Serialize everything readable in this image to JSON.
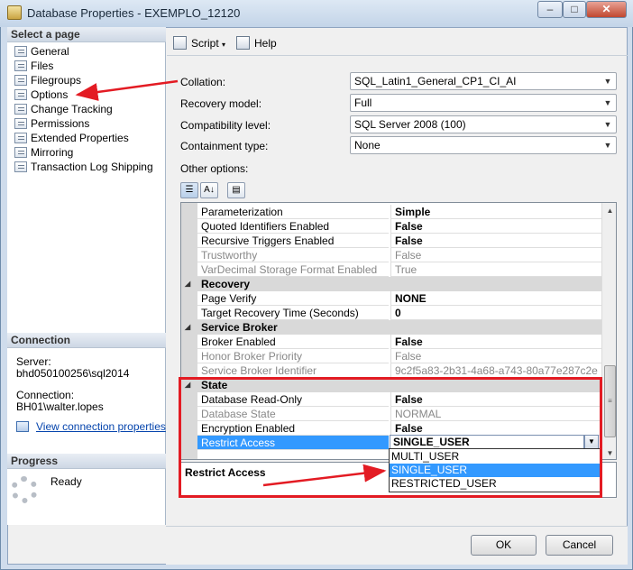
{
  "window": {
    "title": "Database Properties - EXEMPLO_12120",
    "controls": {
      "minimize": "–",
      "maximize": "□",
      "close": "✕"
    }
  },
  "left_panel": {
    "select_page_header": "Select a page",
    "pages": [
      {
        "label": "General",
        "icon": "page-icon"
      },
      {
        "label": "Files",
        "icon": "page-icon"
      },
      {
        "label": "Filegroups",
        "icon": "page-icon"
      },
      {
        "label": "Options",
        "icon": "page-icon"
      },
      {
        "label": "Change Tracking",
        "icon": "page-icon"
      },
      {
        "label": "Permissions",
        "icon": "page-icon"
      },
      {
        "label": "Extended Properties",
        "icon": "page-icon"
      },
      {
        "label": "Mirroring",
        "icon": "page-icon"
      },
      {
        "label": "Transaction Log Shipping",
        "icon": "page-icon"
      }
    ],
    "connection_header": "Connection",
    "server_label": "Server:",
    "server_value": "bhd050100256\\sql2014",
    "connection_label": "Connection:",
    "connection_value": "BH01\\walter.lopes",
    "view_connection_link": "View connection properties",
    "progress_header": "Progress",
    "progress_status": "Ready"
  },
  "toolbar": {
    "script_label": "Script",
    "help_label": "Help"
  },
  "form": {
    "collation_label": "Collation:",
    "collation_value": "SQL_Latin1_General_CP1_CI_AI",
    "recovery_model_label": "Recovery model:",
    "recovery_model_value": "Full",
    "compatibility_label": "Compatibility level:",
    "compatibility_value": "SQL Server 2008 (100)",
    "containment_label": "Containment type:",
    "containment_value": "None",
    "other_options_label": "Other options:"
  },
  "grid": {
    "rows": [
      {
        "type": "prop",
        "name": "Parameterization",
        "value": "Simple"
      },
      {
        "type": "prop",
        "name": "Quoted Identifiers Enabled",
        "value": "False"
      },
      {
        "type": "prop",
        "name": "Recursive Triggers Enabled",
        "value": "False"
      },
      {
        "type": "prop",
        "name": "Trustworthy",
        "value": "False",
        "disabled": true
      },
      {
        "type": "prop",
        "name": "VarDecimal Storage Format Enabled",
        "value": "True",
        "disabled": true
      },
      {
        "type": "cat",
        "name": "Recovery"
      },
      {
        "type": "prop",
        "name": "Page Verify",
        "value": "NONE"
      },
      {
        "type": "prop",
        "name": "Target Recovery Time (Seconds)",
        "value": "0"
      },
      {
        "type": "cat",
        "name": "Service Broker"
      },
      {
        "type": "prop",
        "name": "Broker Enabled",
        "value": "False"
      },
      {
        "type": "prop",
        "name": "Honor Broker Priority",
        "value": "False",
        "disabled": true
      },
      {
        "type": "prop",
        "name": "Service Broker Identifier",
        "value": "9c2f5a83-2b31-4a68-a743-80a77e287c2e",
        "disabled": true
      },
      {
        "type": "cat",
        "name": "State"
      },
      {
        "type": "prop",
        "name": "Database Read-Only",
        "value": "False"
      },
      {
        "type": "prop",
        "name": "Database State",
        "value": "NORMAL",
        "disabled": true
      },
      {
        "type": "prop",
        "name": "Encryption Enabled",
        "value": "False"
      },
      {
        "type": "prop",
        "name": "Restrict Access",
        "value": "SINGLE_USER",
        "selected": true
      }
    ],
    "dropdown_options": [
      "MULTI_USER",
      "SINGLE_USER",
      "RESTRICTED_USER"
    ],
    "dropdown_highlighted": "SINGLE_USER",
    "description_title": "Restrict Access"
  },
  "buttons": {
    "ok": "OK",
    "cancel": "Cancel"
  },
  "colors": {
    "annotation_red": "#e31b23",
    "selection_blue": "#3399ff"
  }
}
